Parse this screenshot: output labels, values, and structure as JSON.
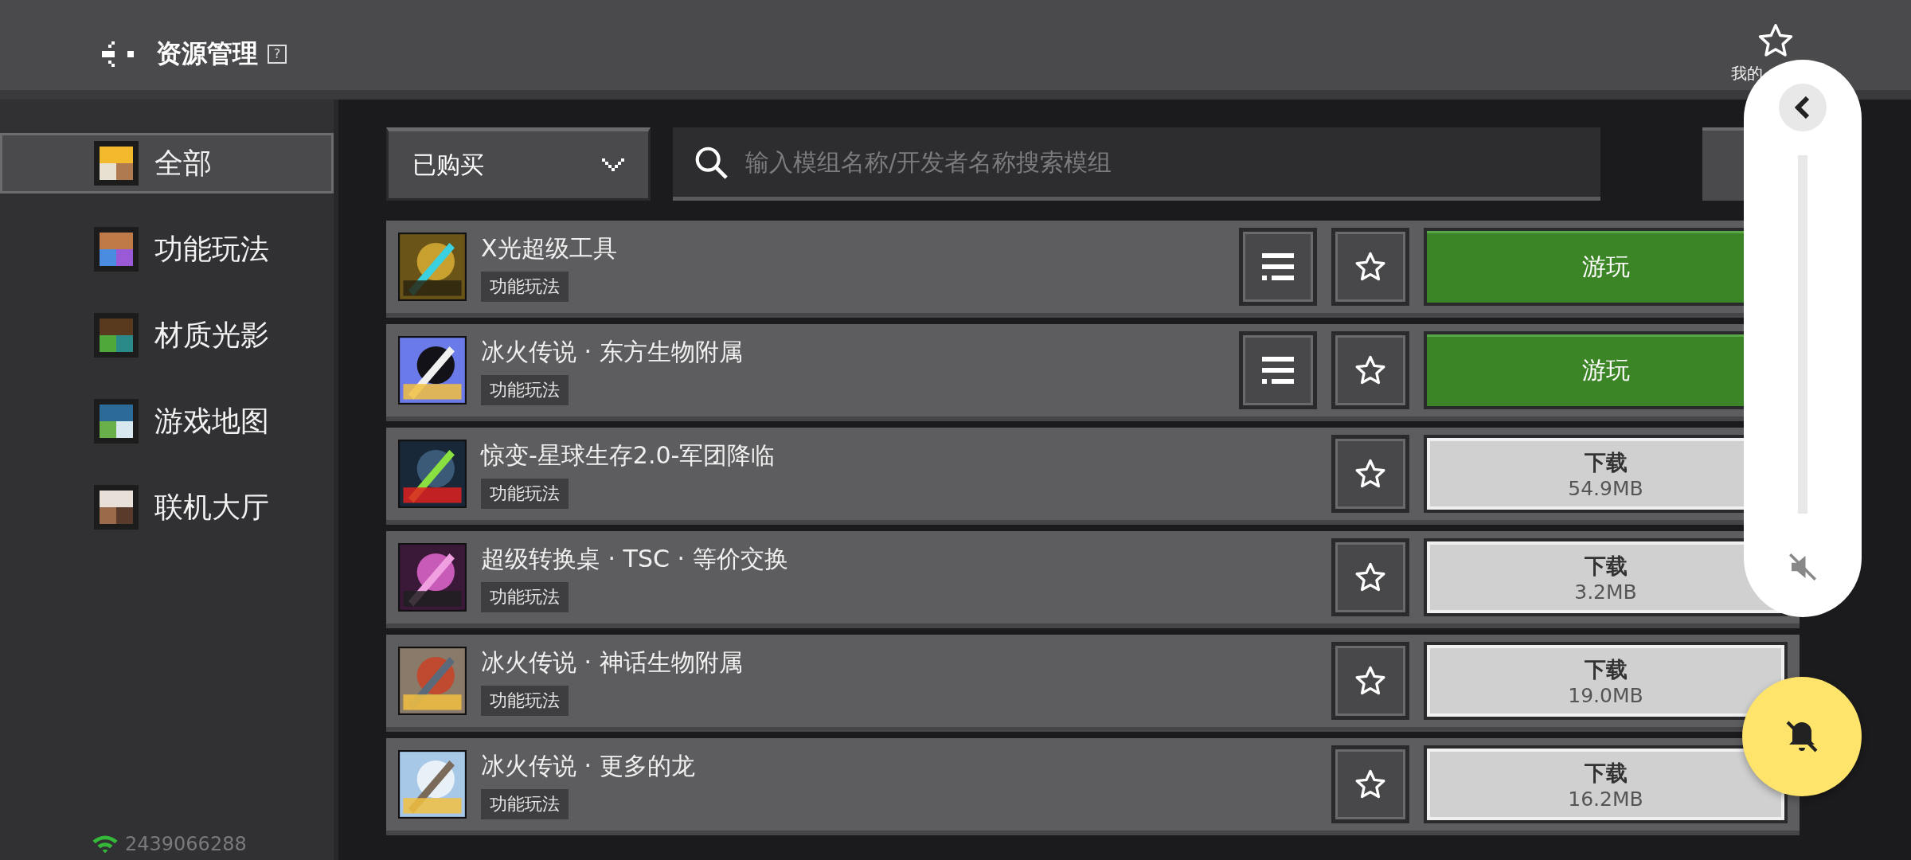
{
  "header": {
    "title": "资源管理",
    "help": "?",
    "favorites_label": "我的"
  },
  "sidebar": {
    "items": [
      {
        "label": "全部",
        "selected": true
      },
      {
        "label": "功能玩法",
        "selected": false
      },
      {
        "label": "材质光影",
        "selected": false
      },
      {
        "label": "游戏地图",
        "selected": false
      },
      {
        "label": "联机大厅",
        "selected": false
      }
    ],
    "account_id": "2439066288"
  },
  "filter": {
    "value": "已购买"
  },
  "search": {
    "placeholder": "输入模组名称/开发者名称搜索模组"
  },
  "mods": [
    {
      "title": "X光超级工具",
      "tag": "功能玩法",
      "menu_button": true,
      "favorited": false,
      "action": {
        "kind": "play",
        "label": "游玩"
      }
    },
    {
      "title": "冰火传说 · 东方生物附属",
      "tag": "功能玩法",
      "menu_button": true,
      "favorited": false,
      "action": {
        "kind": "play",
        "label": "游玩"
      }
    },
    {
      "title": "惊变-星球生存2.0-军团降临",
      "tag": "功能玩法",
      "menu_button": false,
      "favorited": false,
      "action": {
        "kind": "download",
        "label": "下载",
        "size": "54.9MB"
      }
    },
    {
      "title": "超级转换桌 · TSC · 等价交换",
      "tag": "功能玩法",
      "menu_button": false,
      "favorited": false,
      "action": {
        "kind": "download",
        "label": "下载",
        "size": "3.2MB"
      }
    },
    {
      "title": "冰火传说 · 神话生物附属",
      "tag": "功能玩法",
      "menu_button": false,
      "favorited": false,
      "action": {
        "kind": "download",
        "label": "下载",
        "size": "19.0MB"
      }
    },
    {
      "title": "冰火传说 · 更多的龙",
      "tag": "功能玩法",
      "menu_button": false,
      "favorited": false,
      "action": {
        "kind": "download",
        "label": "下载",
        "size": "16.2MB"
      }
    }
  ],
  "volume_panel": {
    "level": 0.0,
    "muted": true
  },
  "notification_button": {
    "muted": true
  }
}
